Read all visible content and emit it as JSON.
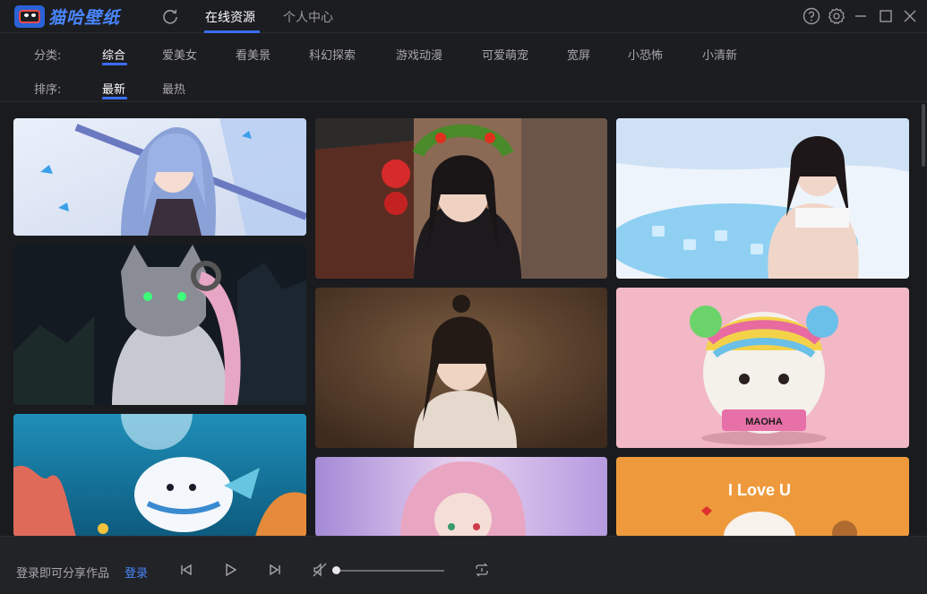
{
  "app": {
    "name": "猫哈壁纸",
    "logo_icon": "cat-face-logo-icon",
    "brand_color": "#4a86ff",
    "accent_color": "#3b6df5"
  },
  "titlebar": {
    "refresh_icon": "refresh-icon",
    "tabs": [
      {
        "label": "在线资源",
        "active": true
      },
      {
        "label": "个人中心",
        "active": false
      }
    ],
    "window_icons": [
      "help-icon",
      "settings-gear-icon",
      "minimize-icon",
      "maximize-icon",
      "close-icon"
    ]
  },
  "filters": {
    "category_label": "分类:",
    "categories": [
      {
        "label": "综合",
        "active": true
      },
      {
        "label": "爱美女",
        "active": false
      },
      {
        "label": "看美景",
        "active": false
      },
      {
        "label": "科幻探索",
        "active": false
      },
      {
        "label": "游戏动漫",
        "active": false
      },
      {
        "label": "可爱萌宠",
        "active": false
      },
      {
        "label": "宽屏",
        "active": false
      },
      {
        "label": "小恐怖",
        "active": false
      },
      {
        "label": "小清新",
        "active": false
      }
    ],
    "sort_label": "排序:",
    "sorts": [
      {
        "label": "最新",
        "active": true
      },
      {
        "label": "最热",
        "active": false
      }
    ]
  },
  "gallery": {
    "cards": [
      {
        "subject": "anime-swordswoman-wallpaper",
        "text": ""
      },
      {
        "subject": "cyber-cat-warrior-wallpaper",
        "text": ""
      },
      {
        "subject": "cartoon-seal-underwater-wallpaper",
        "text": ""
      },
      {
        "subject": "girl-vegetable-crown-wallpaper",
        "text": ""
      },
      {
        "subject": "portrait-girl-brown-backdrop-wallpaper",
        "text": ""
      },
      {
        "subject": "pink-hair-anime-girl-wallpaper",
        "text": ""
      },
      {
        "subject": "woman-ice-bath-wallpaper",
        "text": ""
      },
      {
        "subject": "knitted-plush-creature-wallpaper",
        "text": "MAOHA"
      },
      {
        "subject": "fluffy-pet-love-wallpaper",
        "text": "I Love U"
      }
    ]
  },
  "footer": {
    "share_text": "登录即可分享作品",
    "login_label": "登录",
    "controls": [
      "previous-icon",
      "play-icon",
      "next-icon",
      "mute-icon",
      "loop-icon"
    ],
    "volume": 0.0
  }
}
